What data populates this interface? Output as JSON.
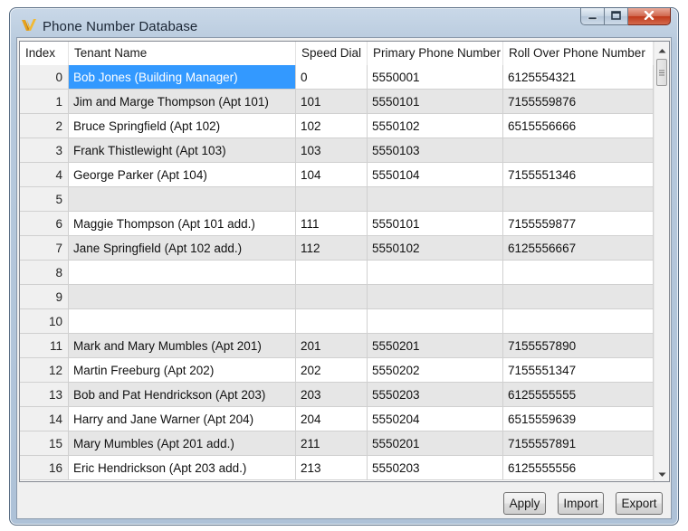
{
  "window": {
    "title": "Phone Number Database",
    "accent_color": "#3399ff"
  },
  "grid": {
    "columns": [
      "Index",
      "Tenant Name",
      "Speed Dial",
      "Primary Phone Number",
      "Roll Over Phone Number"
    ],
    "selected_cell": {
      "row": 0,
      "column": "Tenant Name"
    },
    "rows": [
      [
        "0",
        "Bob Jones (Building Manager)",
        "0",
        "5550001",
        "6125554321"
      ],
      [
        "1",
        "Jim and Marge Thompson (Apt 101)",
        "101",
        "5550101",
        "7155559876"
      ],
      [
        "2",
        "Bruce Springfield (Apt 102)",
        "102",
        "5550102",
        "6515556666"
      ],
      [
        "3",
        "Frank Thistlewight (Apt 103)",
        "103",
        "5550103",
        ""
      ],
      [
        "4",
        "George Parker (Apt 104)",
        "104",
        "5550104",
        "7155551346"
      ],
      [
        "5",
        "",
        "",
        "",
        ""
      ],
      [
        "6",
        "Maggie Thompson (Apt 101 add.)",
        "111",
        "5550101",
        "7155559877"
      ],
      [
        "7",
        "Jane Springfield (Apt 102 add.)",
        "112",
        "5550102",
        "6125556667"
      ],
      [
        "8",
        "",
        "",
        "",
        ""
      ],
      [
        "9",
        "",
        "",
        "",
        ""
      ],
      [
        "10",
        "",
        "",
        "",
        ""
      ],
      [
        "11",
        "Mark and Mary Mumbles (Apt 201)",
        "201",
        "5550201",
        "7155557890"
      ],
      [
        "12",
        "Martin Freeburg (Apt 202)",
        "202",
        "5550202",
        "7155551347"
      ],
      [
        "13",
        "Bob and Pat Hendrickson (Apt 203)",
        "203",
        "5550203",
        "6125555555"
      ],
      [
        "14",
        "Harry and Jane Warner (Apt 204)",
        "204",
        "5550204",
        "6515559639"
      ],
      [
        "15",
        "Mary Mumbles (Apt 201 add.)",
        "211",
        "5550201",
        "7155557891"
      ],
      [
        "16",
        "Eric Hendrickson (Apt 203 add.)",
        "213",
        "5550203",
        "6125555556"
      ]
    ]
  },
  "buttons": {
    "apply": "Apply",
    "import": "Import",
    "export": "Export"
  },
  "icons": [
    "app-logo-icon",
    "minimize-icon",
    "maximize-icon",
    "close-icon",
    "scroll-up-arrow-icon",
    "scroll-down-arrow-icon"
  ]
}
